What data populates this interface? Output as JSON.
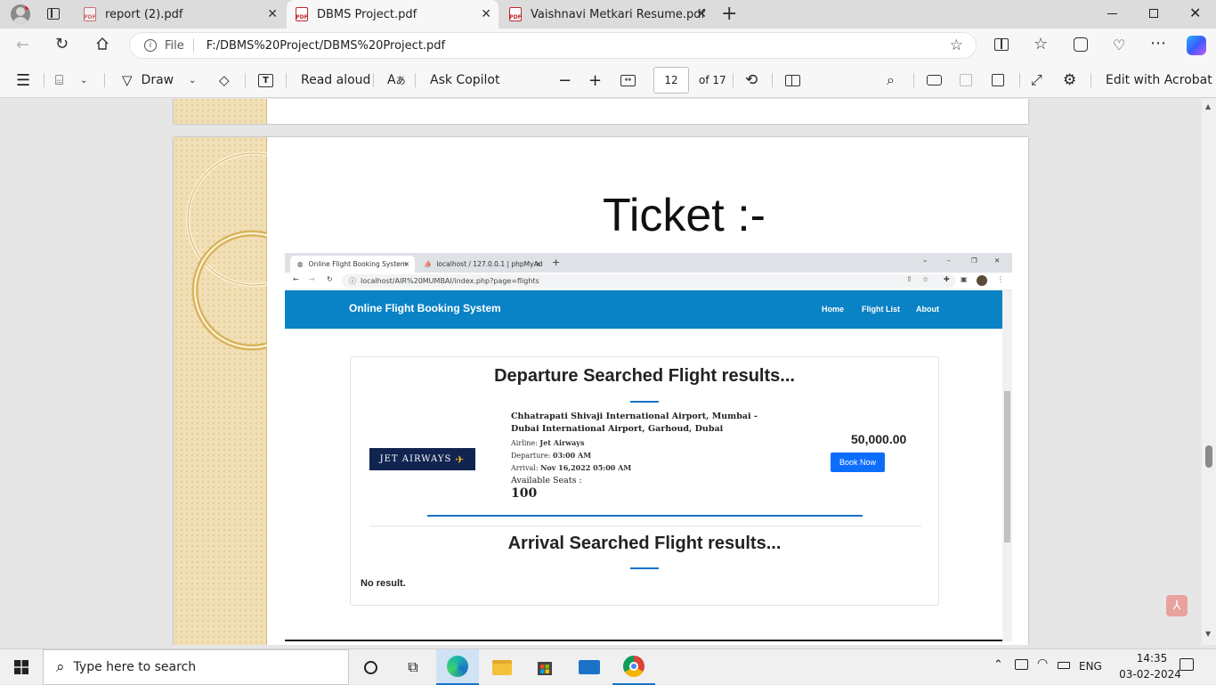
{
  "browser": {
    "tabs": [
      {
        "title": "report (2).pdf"
      },
      {
        "title": "DBMS Project.pdf"
      },
      {
        "title": "Vaishnavi Metkari Resume.pdf"
      }
    ],
    "address": {
      "scheme": "File",
      "url": "F:/DBMS%20Project/DBMS%20Project.pdf"
    }
  },
  "pdf_toolbar": {
    "draw_label": "Draw",
    "read_aloud_label": "Read aloud",
    "ask_copilot_label": "Ask Copilot",
    "page_number": "12",
    "page_total": "of 17",
    "edit_acrobat_label": "Edit with Acrobat"
  },
  "document": {
    "heading": "Ticket :-",
    "screenshot": {
      "tabs": [
        {
          "title": "Online Flight Booking System"
        },
        {
          "title": "localhost / 127.0.0.1 | phpMyAd"
        }
      ],
      "url": "localhost/AIR%20MUMBAI/index.php?page=flights",
      "site": {
        "brand": "Online Flight Booking System",
        "nav": [
          "Home",
          "Flight List",
          "About"
        ]
      },
      "departure": {
        "title": "Departure Searched Flight results...",
        "logo_text": "JET AIRWAYS",
        "route": "Chhatrapati Shivaji International Airport, Mumbai - Dubai International Airport, Garhoud, Dubai",
        "airline_label": "Airline:",
        "airline": "Jet Airways",
        "departure_label": "Departure:",
        "departure_time": "03:00 AM",
        "arrival_label": "Arrival:",
        "arrival_time": "Nov 16,2022 05:00 AM",
        "seats_label": "Available Seats :",
        "seats": "100",
        "price": "50,000.00",
        "book_label": "Book Now"
      },
      "arrival": {
        "title": "Arrival Searched Flight results...",
        "empty_text": "No result."
      }
    }
  },
  "taskbar": {
    "search_placeholder": "Type here to search",
    "language": "ENG",
    "time": "14:35",
    "date": "03-02-2024"
  },
  "colors": {
    "site_nav": "#0a82c6",
    "book_button": "#0d6efd",
    "accent_rule": "#1a73c8",
    "pdf_icon": "#c1272d"
  }
}
